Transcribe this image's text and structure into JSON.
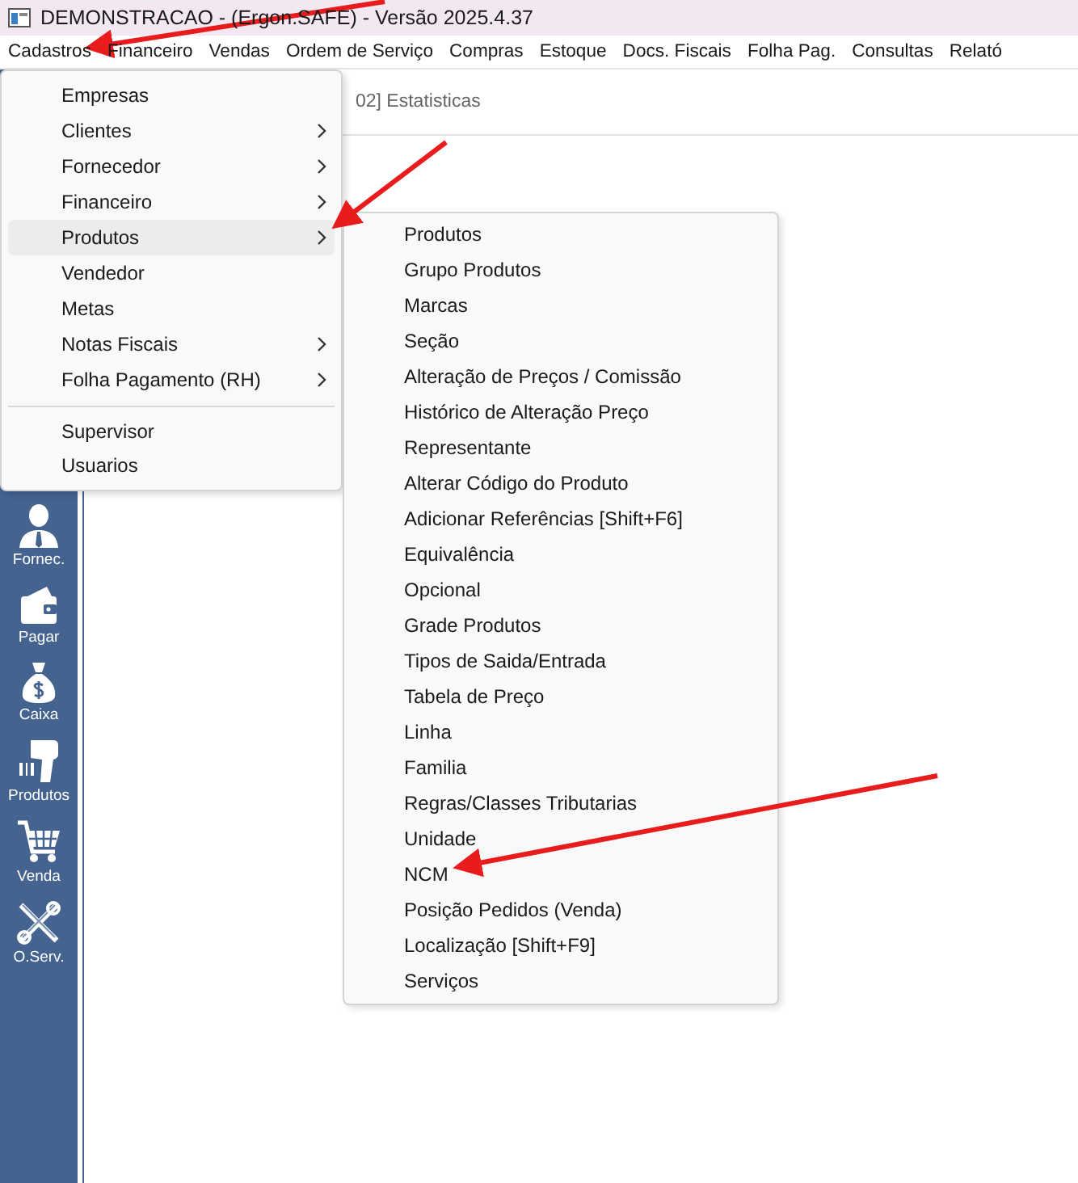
{
  "window": {
    "title": "DEMONSTRACAO - (Ergon.SAFE) - Versão 2025.4.37"
  },
  "menu_bar": [
    "Cadastros",
    "Financeiro",
    "Vendas",
    "Ordem de Serviço",
    "Compras",
    "Estoque",
    "Docs. Fiscais",
    "Folha Pag.",
    "Consultas",
    "Relató"
  ],
  "tab": {
    "label": "02] Estatisticas"
  },
  "sidebar": [
    {
      "label": "Fornec.",
      "kind": "person"
    },
    {
      "label": "Pagar",
      "kind": "wallet"
    },
    {
      "label": "Caixa",
      "kind": "moneybag"
    },
    {
      "label": "Produtos",
      "kind": "scanner"
    },
    {
      "label": "Venda",
      "kind": "cart"
    },
    {
      "label": "O.Serv.",
      "kind": "tools"
    }
  ],
  "cadastros_menu": {
    "items": [
      {
        "label": "Empresas",
        "submenu": false,
        "selected": false,
        "separator_before": false
      },
      {
        "label": "Clientes",
        "submenu": true,
        "selected": false,
        "separator_before": false
      },
      {
        "label": "Fornecedor",
        "submenu": true,
        "selected": false,
        "separator_before": false
      },
      {
        "label": "Financeiro",
        "submenu": true,
        "selected": false,
        "separator_before": false
      },
      {
        "label": "Produtos",
        "submenu": true,
        "selected": true,
        "separator_before": false
      },
      {
        "label": "Vendedor",
        "submenu": false,
        "selected": false,
        "separator_before": false
      },
      {
        "label": "Metas",
        "submenu": false,
        "selected": false,
        "separator_before": false
      },
      {
        "label": "Notas Fiscais",
        "submenu": true,
        "selected": false,
        "separator_before": false
      },
      {
        "label": "Folha Pagamento (RH)",
        "submenu": true,
        "selected": false,
        "separator_before": false
      },
      {
        "label": "Supervisor",
        "submenu": false,
        "selected": false,
        "separator_before": true
      },
      {
        "label": "Usuarios",
        "submenu": false,
        "selected": false,
        "separator_before": false
      }
    ]
  },
  "produtos_submenu": {
    "items": [
      "Produtos",
      "Grupo Produtos",
      "Marcas",
      "Seção",
      "Alteração de Preços / Comissão",
      "Histórico de Alteração Preço",
      "Representante",
      "Alterar Código do Produto",
      "Adicionar Referências  [Shift+F6]",
      "Equivalência",
      "Opcional",
      "Grade Produtos",
      "Tipos de Saida/Entrada",
      "Tabela de Preço",
      "Linha",
      "Familia",
      "Regras/Classes Tributarias",
      "Unidade",
      "NCM",
      "Posição Pedidos (Venda)",
      "Localização [Shift+F9]",
      "Serviços"
    ]
  }
}
